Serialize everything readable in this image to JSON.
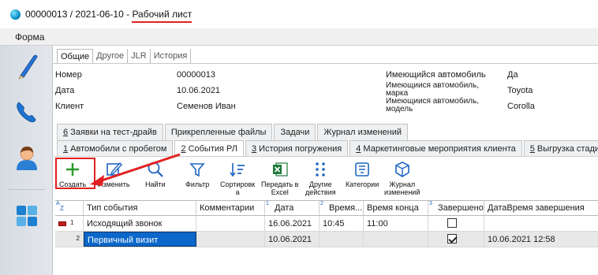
{
  "window": {
    "doc_number": "00000013 / 2021-06-10",
    "separator": " - ",
    "doc_type": "Рабочий лист"
  },
  "menu": {
    "form": "Форма"
  },
  "sidebar": {
    "items": [
      {
        "icon": "pen-icon"
      },
      {
        "icon": "phone-icon"
      },
      {
        "icon": "user-icon"
      },
      {
        "icon": "tiles-icon"
      }
    ]
  },
  "form_tabs": [
    "Общие",
    "Другое",
    "JLR",
    "История"
  ],
  "fields": {
    "number_label": "Номер",
    "number_value": "00000013",
    "date_label": "Дата",
    "date_value": "10.06.2021",
    "client_label": "Клиент",
    "client_value": "Семенов Иван",
    "has_car_label": "Имеющийся автомобиль",
    "has_car_value": "Да",
    "car_brand_label": "Имеющиися автомобиль, марка",
    "car_brand_value": "Toyota",
    "car_model_label": "Имеющиися автомобиль, модель",
    "car_model_value": "Corolla"
  },
  "tabs_row1": [
    {
      "num": "6",
      "label": " Заявки на тест-драйв"
    },
    {
      "num": "",
      "label": "Прикрепленные файлы"
    },
    {
      "num": "",
      "label": "Задачи"
    },
    {
      "num": "",
      "label": "Журнал изменений"
    }
  ],
  "tabs_row2": [
    {
      "num": "1",
      "label": " Автомобили с пробегом"
    },
    {
      "num": "2",
      "label": " События РЛ"
    },
    {
      "num": "3",
      "label": " История погружения"
    },
    {
      "num": "4",
      "label": " Маркетинговые мероприятия клиента"
    },
    {
      "num": "5",
      "label": " Выгрузка стади"
    }
  ],
  "toolbar": {
    "create": "Создать",
    "edit": "Изменить",
    "find": "Найти",
    "filter": "Фильтр",
    "sort_1": "Сортировк",
    "sort_2": "а",
    "excel_1": "Передать в",
    "excel_2": "Excel",
    "other_1": "Другие",
    "other_2": "действия",
    "categories": "Категории",
    "journal_1": "Журнал",
    "journal_2": "изменений"
  },
  "grid": {
    "columns": {
      "type": "Тип события",
      "comments": "Комментарии",
      "date": "Дата",
      "time": "Время...",
      "time_end": "Время конца",
      "done": "Завершено",
      "done_at": "ДатаВремя завершения"
    },
    "sort_flags": {
      "a": "A",
      "z": "Z",
      "n1": "1",
      "n2": "2",
      "n3": "3"
    },
    "rows": [
      {
        "num": "1",
        "type": "Исходящий звонок",
        "comment": "",
        "date": "16.06.2021",
        "time": "10:45",
        "time_end": "11:00",
        "done": false,
        "done_at": ""
      },
      {
        "num": "2",
        "type": "Первичный визит",
        "comment": "",
        "date": "10.06.2021",
        "time": "",
        "time_end": "",
        "done": true,
        "done_at": "10.06.2021 12:58"
      }
    ]
  },
  "colors": {
    "accent_red": "#e02020",
    "selection_blue": "#0b67c9"
  }
}
